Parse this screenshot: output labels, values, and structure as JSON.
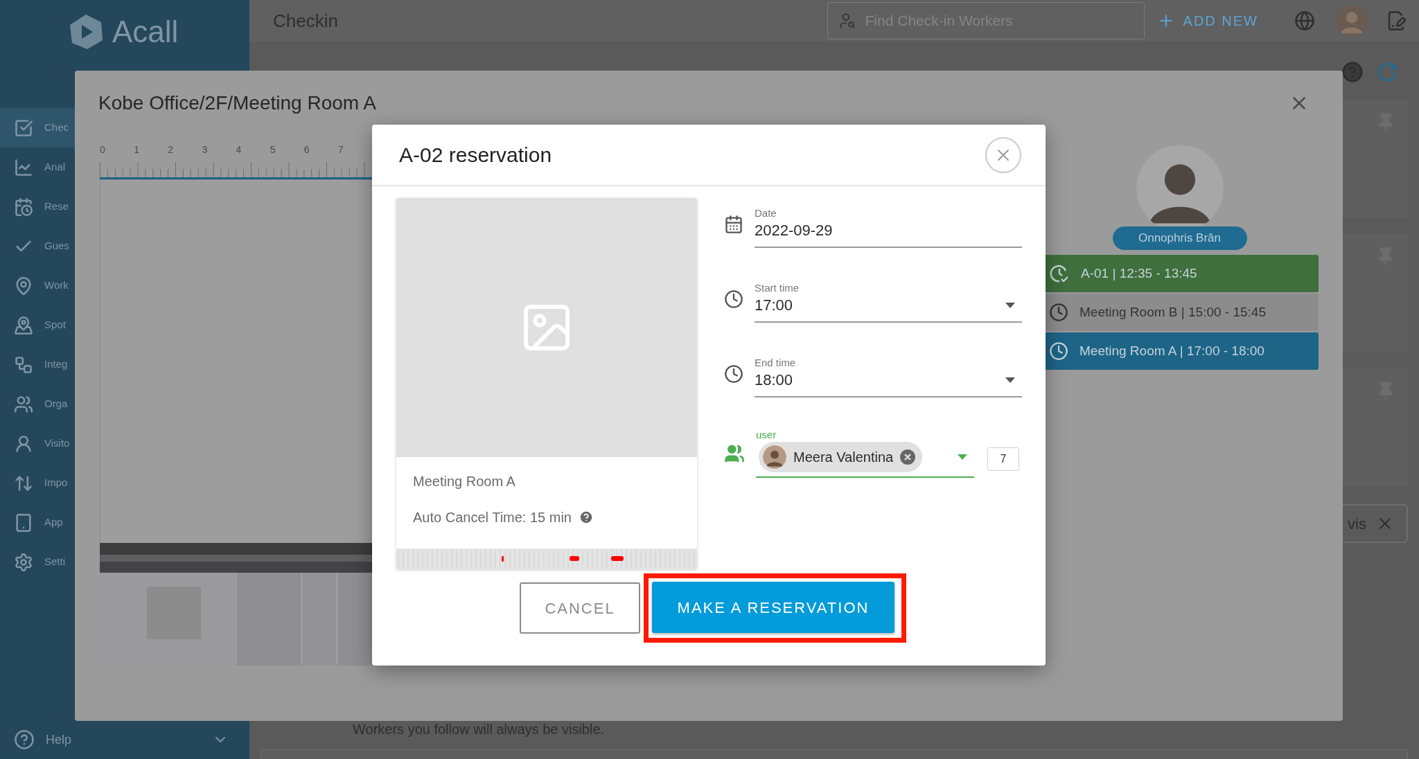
{
  "sidebar": {
    "logo": "Acall",
    "help": "Help",
    "items": [
      {
        "label": "Chec",
        "selected": true
      },
      {
        "label": "Anal",
        "selected": false
      },
      {
        "label": "Rese",
        "selected": false
      },
      {
        "label": "Gues",
        "selected": false
      },
      {
        "label": "Work",
        "selected": false
      },
      {
        "label": "Spot",
        "selected": false
      },
      {
        "label": "Integ",
        "selected": false
      },
      {
        "label": "Orga",
        "selected": false
      },
      {
        "label": "Visito",
        "selected": false
      },
      {
        "label": "Impo",
        "selected": false
      },
      {
        "label": "App",
        "selected": false
      },
      {
        "label": "Setti",
        "selected": false
      }
    ]
  },
  "topbar": {
    "title": "Checkin",
    "search": {
      "placeholder": "Find Check-in Workers"
    },
    "add_button": "ADD NEW"
  },
  "background": {
    "chip": "vis",
    "note": "Workers you follow will always be visible."
  },
  "floor_modal": {
    "title": "Kobe Office/2F/Meeting Room A",
    "ruler": [
      "0",
      "1",
      "2",
      "3",
      "4",
      "5",
      "6",
      "7"
    ],
    "person": {
      "name": "Onnophris Brân"
    },
    "reservations": [
      {
        "kind": "checked_in",
        "text": "A-01 | 12:35 - 13:45",
        "color": "#3e6f3c"
      },
      {
        "kind": "booked",
        "text": "Meeting Room B | 15:00 - 15:45",
        "color": "#8c8c8c"
      },
      {
        "kind": "booked",
        "text": "Meeting Room A | 17:00 - 18:00",
        "color": "#1d6487"
      }
    ]
  },
  "dialog": {
    "title": "A-02 reservation",
    "room": {
      "name": "Meeting Room A",
      "auto_cancel": "Auto Cancel Time: 15 min"
    },
    "fields": [
      {
        "kind": "date",
        "label": "Date",
        "value": "2022-09-29"
      },
      {
        "kind": "select",
        "label": "Start time",
        "value": "17:00"
      },
      {
        "kind": "select",
        "label": "End time",
        "value": "18:00"
      }
    ],
    "user": {
      "label": "user",
      "chips": [
        "Meera Valentina"
      ],
      "count": "7"
    },
    "buttons": [
      {
        "kind": "secondary",
        "label": "CANCEL",
        "highlighted": false
      },
      {
        "kind": "primary",
        "label": "MAKE A RESERVATION",
        "highlighted": true
      }
    ]
  }
}
